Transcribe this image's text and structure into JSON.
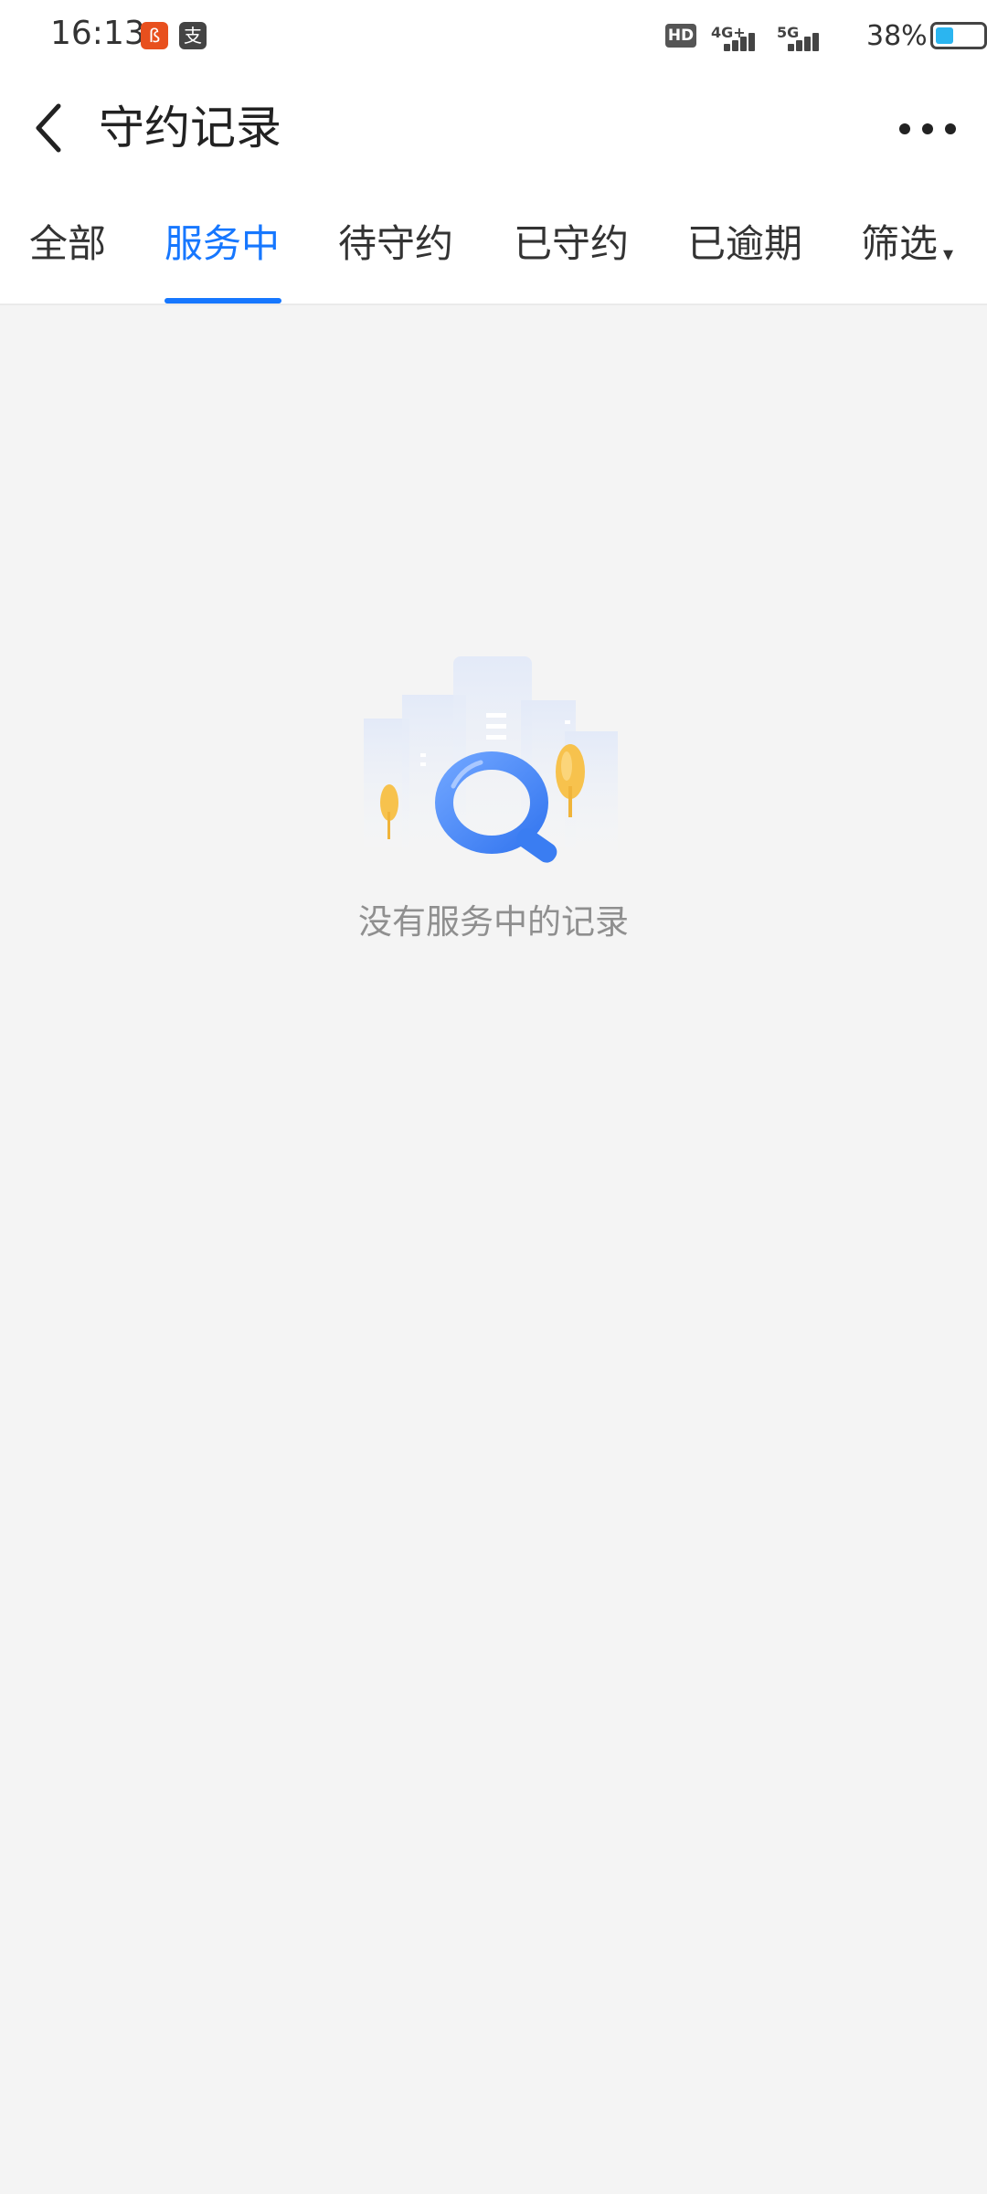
{
  "status_bar": {
    "time": "16:13",
    "app_icons": [
      {
        "name": "notification-app-icon",
        "glyph": "ß",
        "color": "#e8501e"
      },
      {
        "name": "alipay-notification-icon",
        "glyph": "支",
        "color": "#444444"
      }
    ],
    "hd_label": "HD",
    "network_labels": [
      "4G+",
      "5G"
    ],
    "battery_text": "38%",
    "battery_level": 0.38
  },
  "header": {
    "title": "守约记录"
  },
  "tabs": [
    {
      "label": "全部",
      "active": false
    },
    {
      "label": "服务中",
      "active": true
    },
    {
      "label": "待守约",
      "active": false
    },
    {
      "label": "已守约",
      "active": false
    },
    {
      "label": "已逾期",
      "active": false
    },
    {
      "label": "筛选",
      "active": false
    }
  ],
  "filter_caret": "▾",
  "empty_state": {
    "message": "没有服务中的记录"
  },
  "colors": {
    "accent": "#1677ff",
    "background": "#f4f4f4",
    "muted_text": "#8f8f8f"
  }
}
